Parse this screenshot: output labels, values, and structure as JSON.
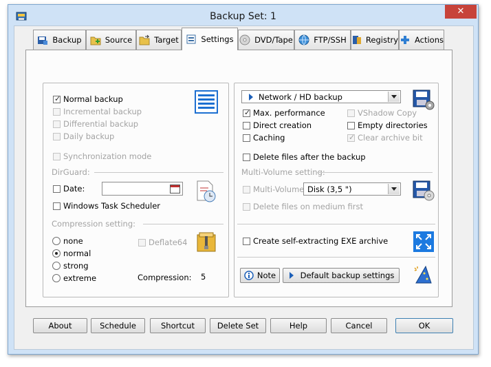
{
  "window": {
    "title": "Backup Set: 1",
    "close_glyph": "✕"
  },
  "tabs": [
    {
      "label": "Backup",
      "icon": "backup-icon"
    },
    {
      "label": "Source",
      "icon": "source-icon"
    },
    {
      "label": "Target",
      "icon": "target-icon"
    },
    {
      "label": "Settings",
      "icon": "settings-icon",
      "active": true
    },
    {
      "label": "DVD/Tape",
      "icon": "dvd-icon"
    },
    {
      "label": "FTP/SSH",
      "icon": "ftp-icon"
    },
    {
      "label": "Registry",
      "icon": "registry-icon"
    },
    {
      "label": "Actions",
      "icon": "actions-icon"
    }
  ],
  "left": {
    "backup_types": [
      {
        "label": "Normal backup",
        "checked": true,
        "enabled": true
      },
      {
        "label": "Incremental backup",
        "checked": false,
        "enabled": false
      },
      {
        "label": "Differential backup",
        "checked": false,
        "enabled": false
      },
      {
        "label": "Daily backup",
        "checked": false,
        "enabled": false
      }
    ],
    "sync_mode": {
      "label": "Synchronization mode",
      "checked": false,
      "enabled": false
    },
    "dirguard": {
      "heading": "DirGuard:",
      "date_label": "Date:",
      "date_value": "",
      "scheduler_label": "Windows Task Scheduler"
    },
    "compression": {
      "heading": "Compression setting:",
      "options": [
        "none",
        "normal",
        "strong",
        "extreme"
      ],
      "selected": "normal",
      "deflate64_label": "Deflate64",
      "level_label": "Compression:",
      "level_value": "5"
    }
  },
  "right": {
    "target_type": "Network / HD backup",
    "options": {
      "max_performance": "Max. performance",
      "direct_creation": "Direct creation",
      "caching": "Caching",
      "vshadow": "VShadow Copy",
      "empty_dirs": "Empty directories",
      "clear_archive": "Clear archive bit"
    },
    "delete_after": "Delete files after the backup",
    "multi_volume": {
      "heading": "Multi-Volume setting:",
      "label": "Multi-Volume",
      "disk_value": "Disk (3,5 \")",
      "delete_first": "Delete files on medium first"
    },
    "sfx_label": "Create self-extracting EXE archive",
    "note_label": "Note",
    "default_label": "Default backup settings"
  },
  "buttons": {
    "about": "About",
    "schedule": "Schedule",
    "shortcut": "Shortcut",
    "delete_set": "Delete Set",
    "help": "Help",
    "cancel": "Cancel",
    "ok": "OK"
  },
  "colors": {
    "accent": "#1c6fd1",
    "window_frame": "#cfe2f6",
    "close_button": "#c7433a"
  }
}
